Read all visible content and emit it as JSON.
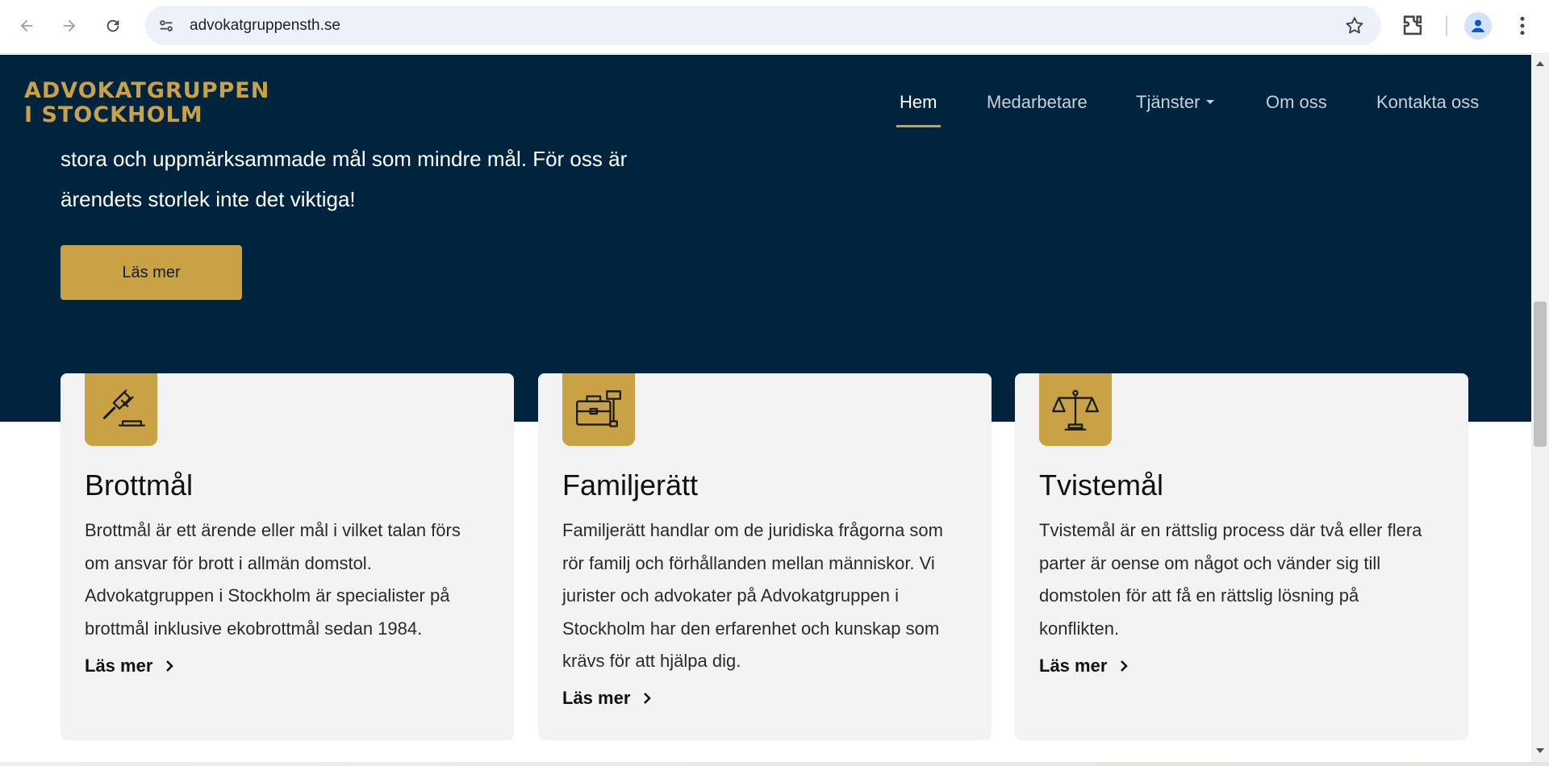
{
  "browser": {
    "url": "advokatgruppensth.se",
    "icons": [
      "back-icon",
      "forward-icon",
      "reload-icon",
      "site-info-icon",
      "bookmark-star-icon",
      "extensions-icon",
      "profile-icon",
      "menu-icon"
    ]
  },
  "site": {
    "logo_line1": "ADVOKATGRUPPEN",
    "logo_line2": "I STOCKHOLM",
    "nav": [
      {
        "label": "Hem"
      },
      {
        "label": "Medarbetare"
      },
      {
        "label": "Tjänster"
      },
      {
        "label": "Om oss"
      },
      {
        "label": "Kontakta oss"
      }
    ],
    "active_nav": "Hem"
  },
  "hero": {
    "line1_partial": "stora och uppmärksammade mål som mindre mål. För oss är",
    "line2": "ärendets storlek inte det viktiga!",
    "button": "Läs mer"
  },
  "cards": [
    {
      "icon": "gavel-icon",
      "title": "Brottmål",
      "description": "Brottmål är ett ärende eller mål i vilket talan förs om ansvar för brott i allmän domstol. Advokatgruppen i Stockholm är specialister på brottmål inklusive ekobrottmål sedan 1984.",
      "link": "Läs mer"
    },
    {
      "icon": "briefcase-gavel-icon",
      "title": "Familjerätt",
      "description": "Familjerätt handlar om de juridiska frågorna som rör familj och förhållanden mellan människor. Vi jurister och advokater på Advokatgruppen i Stockholm har den erfarenhet och kunskap som krävs för att hjälpa dig.",
      "link": "Läs mer"
    },
    {
      "icon": "scales-icon",
      "title": "Tvistemål",
      "description": "Tvistemål är en rättslig process där två eller flera parter är oense om något och vänder sig till domstolen för att få en rättslig lösning på konflikten.",
      "link": "Läs mer"
    }
  ],
  "colors": {
    "navy": "#00243d",
    "gold": "#c9a246",
    "card_bg": "#f3f3f3"
  }
}
